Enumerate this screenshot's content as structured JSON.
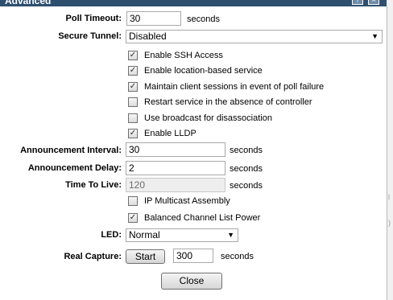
{
  "window": {
    "title": "Advanced",
    "help_glyph": "?",
    "close_glyph": "×"
  },
  "poll_timeout": {
    "label": "Poll Timeout:",
    "value": "30",
    "unit": "seconds"
  },
  "secure_tunnel": {
    "label": "Secure Tunnel:",
    "selected": "Disabled"
  },
  "checkboxes_top": [
    {
      "label": "Enable SSH Access",
      "checked": true
    },
    {
      "label": "Enable location-based service",
      "checked": true
    },
    {
      "label": "Maintain client sessions in event of poll failure",
      "checked": true
    },
    {
      "label": "Restart service in the absence of controller",
      "checked": false
    },
    {
      "label": "Use broadcast for disassociation",
      "checked": false
    },
    {
      "label": "Enable LLDP",
      "checked": true
    }
  ],
  "announcement_interval": {
    "label": "Announcement Interval:",
    "value": "30",
    "unit": "seconds"
  },
  "announcement_delay": {
    "label": "Announcement Delay:",
    "value": "2",
    "unit": "seconds"
  },
  "time_to_live": {
    "label": "Time To Live:",
    "value": "120",
    "unit": "seconds"
  },
  "checkboxes_bottom": [
    {
      "label": "IP Multicast Assembly",
      "checked": false
    },
    {
      "label": "Balanced Channel List Power",
      "checked": true
    }
  ],
  "led": {
    "label": "LED:",
    "selected": "Normal"
  },
  "real_capture": {
    "label": "Real Capture:",
    "button": "Start",
    "value": "300",
    "unit": "seconds"
  },
  "close_button": "Close",
  "colors": {
    "titlebar": "#2f4f6f",
    "dialog_bg": "#ffffff",
    "page_bg": "#e8e8e8"
  },
  "check_glyph": "✓"
}
